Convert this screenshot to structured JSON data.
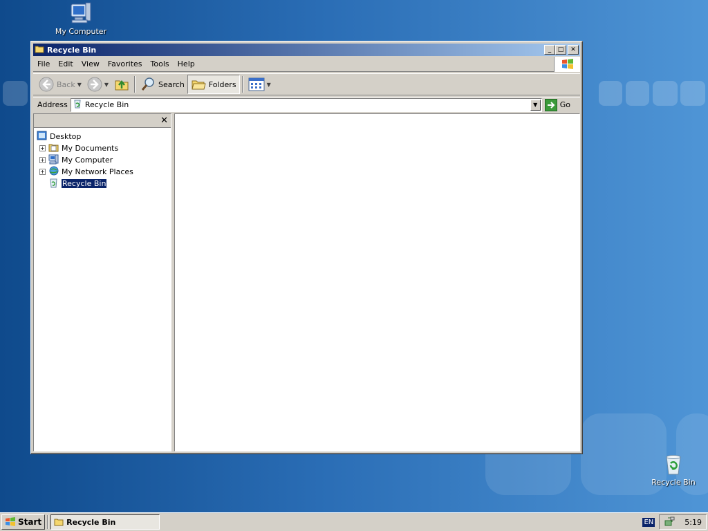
{
  "desktop": {
    "icons": [
      {
        "label": "My Computer"
      },
      {
        "label": "Recycle Bin"
      }
    ]
  },
  "window": {
    "title": "Recycle Bin",
    "menu": [
      {
        "label": "File"
      },
      {
        "label": "Edit"
      },
      {
        "label": "View"
      },
      {
        "label": "Favorites"
      },
      {
        "label": "Tools"
      },
      {
        "label": "Help"
      }
    ],
    "toolbar": {
      "back": "Back",
      "search": "Search",
      "folders": "Folders"
    },
    "address": {
      "label": "Address",
      "value": "Recycle Bin",
      "go": "Go"
    },
    "folders_pane": {
      "tree": [
        {
          "label": "Desktop",
          "icon": "desktop-icon"
        },
        {
          "label": "My Documents",
          "icon": "my-documents-icon"
        },
        {
          "label": "My Computer",
          "icon": "my-computer-icon"
        },
        {
          "label": "My Network Places",
          "icon": "network-places-icon"
        },
        {
          "label": "Recycle Bin",
          "icon": "recycle-bin-icon",
          "selected": true
        }
      ]
    }
  },
  "taskbar": {
    "start": "Start",
    "task": "Recycle Bin",
    "language": "EN",
    "clock": "5:19"
  },
  "colors": {
    "titlebar_start": "#0a246a",
    "titlebar_end": "#a6caf0",
    "face": "#d4d0c8",
    "selection": "#0a246a"
  }
}
